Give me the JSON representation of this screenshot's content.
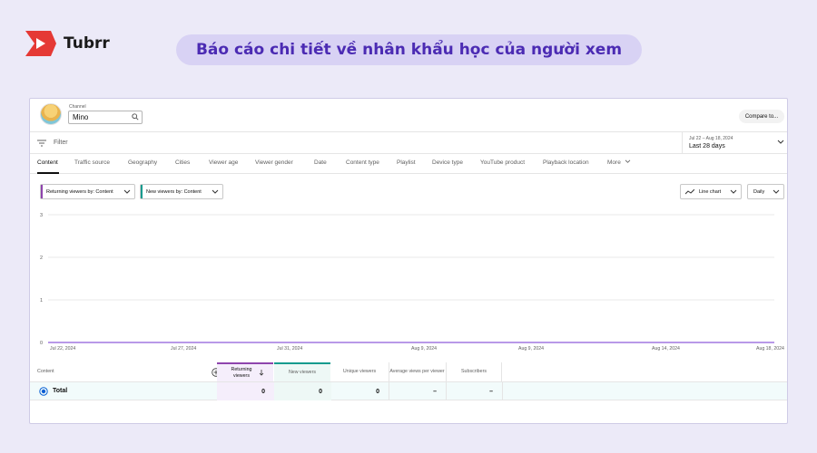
{
  "brand": {
    "name": "Tubrr"
  },
  "headline": "Báo cáo chi tiết về nhân khẩu học của người xem",
  "channel": {
    "label": "Channel",
    "value": "Mino"
  },
  "compare_button": "Compare to...",
  "filter": {
    "placeholder": "Filter"
  },
  "date_range": {
    "range": "Jul 22 – Aug 18, 2024",
    "label": "Last 28 days"
  },
  "tabs": [
    "Content",
    "Traffic source",
    "Geography",
    "Cities",
    "Viewer age",
    "Viewer gender",
    "Date",
    "Content type",
    "Playlist",
    "Device type",
    "YouTube product",
    "Playback location",
    "More"
  ],
  "chips": {
    "returning": "Returning viewers by: Content",
    "new": "New viewers by: Content",
    "chart_type": "Line chart",
    "interval": "Daily"
  },
  "colors": {
    "returning": "#8e44ad",
    "new": "#129b8e",
    "line": "#8e5cd9",
    "headline": "#4b2bb3",
    "accent": "#e53935"
  },
  "chart_data": {
    "type": "line",
    "x": [
      "Jul 22, 2024",
      "Jul 27, 2024",
      "Jul 31, 2024",
      "Aug 5, 2024",
      "Aug 9, 2024",
      "Aug 14, 2024",
      "Aug 18, 2024"
    ],
    "x_tick_labels": [
      "Jul 22, 2024",
      "Jul 27, 2024",
      "Jul 31, 2024",
      "Aug 9, 2024",
      "Aug 9, 2024",
      "Aug 14, 2024",
      "Aug 18, 2024"
    ],
    "series": [
      {
        "name": "Returning viewers",
        "values": [
          0,
          0,
          0,
          0,
          0,
          0,
          0
        ]
      }
    ],
    "y_ticks": [
      "3",
      "2",
      "1",
      "0"
    ],
    "ylim": [
      0,
      3
    ],
    "grid": true
  },
  "table": {
    "headers": {
      "content": "Content",
      "returning": "Returning viewers",
      "new": "New viewers",
      "unique": "Unique viewers",
      "avg": "Average views per viewer",
      "subs": "Subscribers"
    },
    "total_row": {
      "label": "Total",
      "returning": "0",
      "new": "0",
      "unique": "0",
      "avg": "–",
      "subs": "–"
    }
  }
}
